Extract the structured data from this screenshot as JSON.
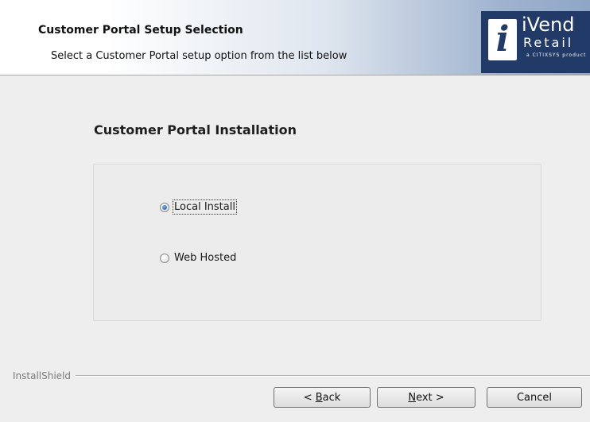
{
  "header": {
    "title": "Customer Portal Setup Selection",
    "subtitle": "Select a Customer Portal setup option from the list below",
    "logo": {
      "glyph": "i",
      "brand": "iVend",
      "line2": "Retail",
      "tagline": "a CITIXSYS product"
    }
  },
  "section": {
    "title": "Customer Portal Installation"
  },
  "options": [
    {
      "label": "Local Install",
      "checked": true
    },
    {
      "label": "Web Hosted",
      "checked": false
    }
  ],
  "footer": {
    "brand": "InstallShield"
  },
  "buttons": {
    "back": {
      "prefix": "< ",
      "accel": "B",
      "rest": "ack"
    },
    "next": {
      "accel": "N",
      "rest": "ext >"
    },
    "cancel": "Cancel"
  },
  "colors": {
    "logo_bg": "#213a68",
    "radio_fill": "#2b5fa0"
  }
}
